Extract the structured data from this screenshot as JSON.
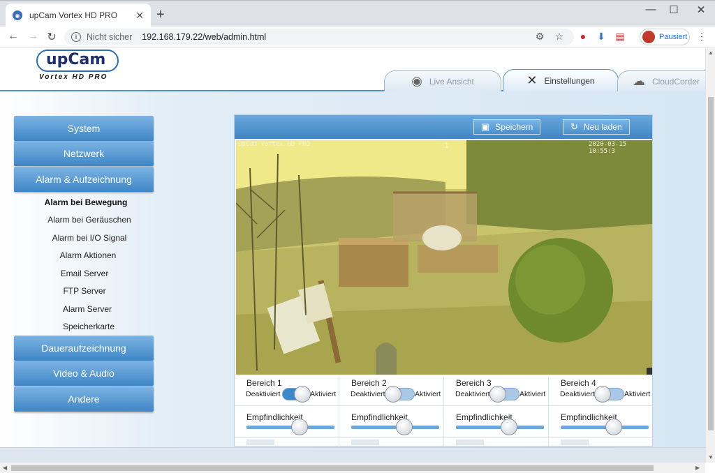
{
  "browser": {
    "tab_title": "upCam Vortex HD PRO",
    "new_tab": "+",
    "security_label": "Nicht sicher",
    "url": "192.168.179.22/web/admin.html",
    "profile_label": "Pausiert",
    "minimize": "—",
    "maximize": "☐",
    "close": "✕"
  },
  "logo": {
    "name": "upCam",
    "subtitle": "Vortex HD PRO"
  },
  "main_tabs": [
    {
      "label": "Live Ansicht",
      "icon": "eye-icon",
      "active": false
    },
    {
      "label": "Einstellungen",
      "icon": "tools-icon",
      "active": true
    },
    {
      "label": "CloudCorder",
      "icon": "cloudcorder-icon",
      "active": false
    }
  ],
  "sidebar": {
    "top_items": [
      "System",
      "Netzwerk",
      "Alarm & Aufzeichnung"
    ],
    "sub_items": [
      {
        "label": "Alarm bei Bewegung",
        "active": true
      },
      {
        "label": "Alarm bei Geräuschen",
        "active": false
      },
      {
        "label": "Alarm bei I/O Signal",
        "active": false
      },
      {
        "label": "Alarm Aktionen",
        "active": false
      },
      {
        "label": "Email Server",
        "active": false
      },
      {
        "label": "FTP Server",
        "active": false
      },
      {
        "label": "Alarm Server",
        "active": false
      },
      {
        "label": "Speicherkarte",
        "active": false
      }
    ],
    "bottom_items": [
      "Daueraufzeichnung",
      "Video & Audio",
      "Andere"
    ]
  },
  "panel": {
    "save_label": "Speichern",
    "reload_label": "Neu laden",
    "camera": {
      "osd_name": "upCam Vortex HD PRO",
      "osd_channel": "1",
      "osd_time": "2020-03-15 10:55:3"
    },
    "areas": [
      {
        "title": "Bereich 1",
        "off_label": "Deaktiviert",
        "on_label": "Aktiviert",
        "enabled": true,
        "sens_label": "Empfindlichkeit",
        "sensitivity": 0.6
      },
      {
        "title": "Bereich 2",
        "off_label": "Deaktiviert",
        "on_label": "Aktiviert",
        "enabled": false,
        "sens_label": "Empfindlichkeit",
        "sensitivity": 0.6
      },
      {
        "title": "Bereich 3",
        "off_label": "Deaktiviert",
        "on_label": "Aktiviert",
        "enabled": false,
        "sens_label": "Empfindlichkeit",
        "sensitivity": 0.6
      },
      {
        "title": "Bereich 4",
        "off_label": "Deaktiviert",
        "on_label": "Aktiviert",
        "enabled": false,
        "sens_label": "Empfindlichkeit",
        "sensitivity": 0.6
      }
    ]
  },
  "colors": {
    "accent": "#3f86c5",
    "header_line": "#4f8fc8",
    "camera_tint": "#c4c66a"
  }
}
